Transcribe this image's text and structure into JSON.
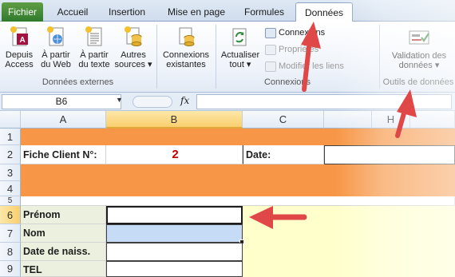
{
  "tabs": [
    {
      "label": "Fichier"
    },
    {
      "label": "Accueil"
    },
    {
      "label": "Insertion"
    },
    {
      "label": "Mise en page"
    },
    {
      "label": "Formules"
    },
    {
      "label": "Données"
    }
  ],
  "ribbon": {
    "external": {
      "access_l1": "Depuis",
      "access_l2": "Access",
      "web_l1": "À partir",
      "web_l2": "du Web",
      "text_l1": "À partir",
      "text_l2": "du texte",
      "other_l1": "Autres",
      "other_l2": "sources ▾",
      "group_label": "Données externes"
    },
    "existing": {
      "l1": "Connexions",
      "l2": "existantes"
    },
    "connections": {
      "refresh_l1": "Actualiser",
      "refresh_l2": "tout ▾",
      "connexions": "Connexions",
      "proprietes": "Propriétés",
      "modifier": "Modifier les liens",
      "group_label": "Connexions"
    },
    "tools": {
      "validation_l1": "Validation des",
      "validation_l2": "données ▾",
      "group_label": "Outils de données"
    }
  },
  "formula_bar": {
    "name_box": "B6",
    "fx": "fx",
    "content": ""
  },
  "grid": {
    "columns": [
      "A",
      "B",
      "C",
      "H"
    ],
    "rows": [
      "1",
      "2",
      "3",
      "4",
      "5",
      "6",
      "7",
      "8",
      "9"
    ],
    "cells": {
      "a2": "Fiche Client N°:",
      "b2": "2",
      "c2": "Date:",
      "a6": "Prénom",
      "a7": "Nom",
      "a8": "Date de naiss.",
      "a9": "TEL"
    }
  },
  "colors": {
    "orange_fill": "#f79646",
    "client_number": "#c00000",
    "arrow": "#e53f3f",
    "selection": "#c6dbf5"
  }
}
